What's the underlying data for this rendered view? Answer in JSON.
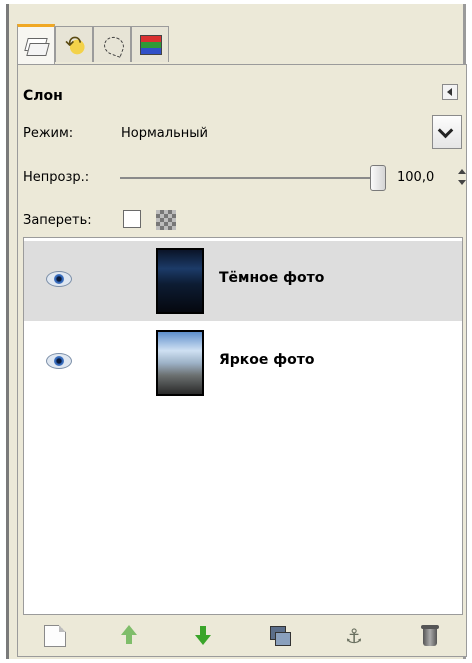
{
  "tabs": [
    {
      "icon": "layers-icon",
      "active": true
    },
    {
      "icon": "undo-history-icon",
      "active": false
    },
    {
      "icon": "paths-icon",
      "active": false
    },
    {
      "icon": "channels-icon",
      "active": false
    }
  ],
  "panel": {
    "title": "Слон",
    "mode_label": "Режим:",
    "mode_value": "Нормальный",
    "opacity_label": "Непрозр.:",
    "opacity_value": "100,0",
    "opacity_level": 1.0,
    "lock_label": "Запереть:"
  },
  "layers": [
    {
      "name": "Тёмное фото",
      "visible": true,
      "selected": true
    },
    {
      "name": "Яркое фото",
      "visible": true,
      "selected": false
    }
  ],
  "bottom_toolbar": [
    "new-layer-icon",
    "raise-layer-icon",
    "lower-layer-icon",
    "duplicate-layer-icon",
    "anchor-layer-icon",
    "delete-layer-icon"
  ]
}
